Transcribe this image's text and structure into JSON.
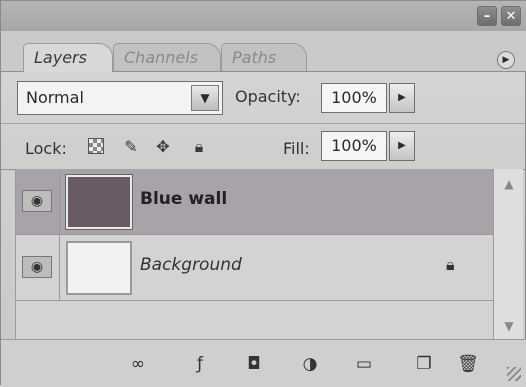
{
  "tabs": [
    {
      "label": "Layers",
      "active": true
    },
    {
      "label": "Channels",
      "active": false
    },
    {
      "label": "Paths",
      "active": false
    }
  ],
  "blend_mode": {
    "selected": "Normal"
  },
  "opacity": {
    "label": "Opacity:",
    "value": "100%"
  },
  "lock": {
    "label": "Lock:"
  },
  "fill": {
    "label": "Fill:",
    "value": "100%"
  },
  "layers": [
    {
      "name": "Blue wall",
      "selected": true,
      "visible": true,
      "thumb_color": "#6a5a63"
    },
    {
      "name": "Background",
      "selected": false,
      "visible": true,
      "locked": true
    }
  ],
  "icons": {
    "minimize": "minimize-icon",
    "close": "close-icon",
    "panel_menu": "panel-menu-icon",
    "eye": "eye-icon",
    "lock": "lock-icon",
    "link": "link-icon",
    "fx": "fx-icon",
    "mask": "mask-icon",
    "adjustment": "adjustment-layer-icon",
    "group": "folder-icon",
    "new_layer": "new-layer-icon",
    "trash": "trash-icon"
  }
}
